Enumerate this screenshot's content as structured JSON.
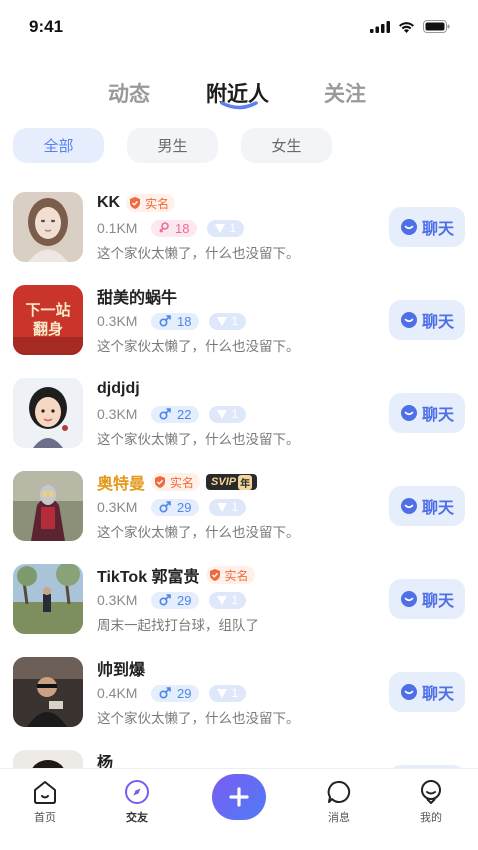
{
  "status_bar": {
    "time": "9:41"
  },
  "top_tabs": [
    {
      "label": "动态"
    },
    {
      "label": "附近人"
    },
    {
      "label": "关注"
    }
  ],
  "filters": [
    {
      "label": "全部"
    },
    {
      "label": "男生"
    },
    {
      "label": "女生"
    }
  ],
  "verified_label": "实名",
  "chat_label": "聊天",
  "users": [
    {
      "name": "KK",
      "verified": true,
      "distance": "0.1KM",
      "gender": "female",
      "age": "18",
      "level": "1",
      "bio": "这个家伙太懒了，什么也没留下。"
    },
    {
      "name": "甜美的蜗牛",
      "verified": false,
      "distance": "0.3KM",
      "gender": "male",
      "age": "18",
      "level": "1",
      "bio": "这个家伙太懒了，什么也没留下。",
      "avatar_text_1": "下一站",
      "avatar_text_2": "翻身"
    },
    {
      "name": "djdjdj",
      "verified": false,
      "distance": "0.3KM",
      "gender": "male",
      "age": "22",
      "level": "1",
      "bio": "这个家伙太懒了，什么也没留下。"
    },
    {
      "name": "奥特曼",
      "verified": true,
      "vip": true,
      "vip_label": "SVIP",
      "vip_year": "年",
      "distance": "0.3KM",
      "gender": "male",
      "age": "29",
      "level": "1",
      "bio": "这个家伙太懒了，什么也没留下。"
    },
    {
      "name": "TikTok 郭富贵",
      "verified": true,
      "distance": "0.3KM",
      "gender": "male",
      "age": "29",
      "level": "1",
      "bio": "周末一起找打台球，组队了"
    },
    {
      "name": "帅到爆",
      "verified": false,
      "distance": "0.4KM",
      "gender": "male",
      "age": "29",
      "level": "1",
      "bio": "这个家伙太懒了，什么也没留下。"
    },
    {
      "name": "杨",
      "verified": false,
      "distance": "",
      "gender": "male",
      "age": "",
      "level": "",
      "bio": ""
    }
  ],
  "bottom_nav": [
    {
      "label": "首页",
      "icon": "home-icon"
    },
    {
      "label": "交友",
      "icon": "compass-icon"
    },
    {
      "label": "",
      "icon": "plus-icon"
    },
    {
      "label": "消息",
      "icon": "message-icon"
    },
    {
      "label": "我的",
      "icon": "profile-icon"
    }
  ],
  "colors": {
    "accent": "#4e6fe6",
    "filter_active_bg": "#e6edfd",
    "female": "#ec6d96",
    "male": "#4f86e8",
    "verified": "#ef6a3c",
    "vip_name": "#e39a1c"
  }
}
